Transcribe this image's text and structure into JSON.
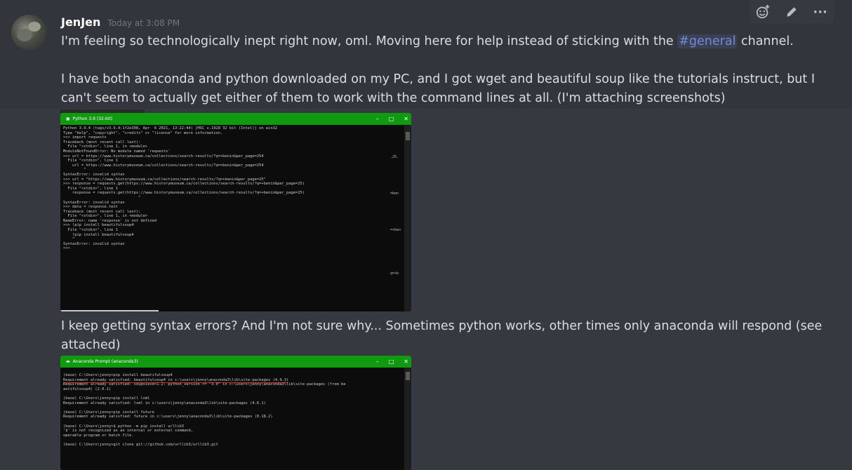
{
  "message": {
    "username": "JenJen",
    "timestamp": "Today at 3:08 PM",
    "p1_before": "I'm feeling so technologically inept right now, oml. Moving here for help instead of sticking with the ",
    "p1_mention": "#general",
    "p1_after": " channel.",
    "p2": "I have both anaconda and python downloaded on my PC, and I got wget and beautiful soup like the tutorials instruct, but I can't seem to actually get either of them to work with the command lines at all. (I'm attaching screenshots)",
    "p3": "I keep getting syntax errors? And I'm not sure why... Sometimes python works, other times only anaconda will respond (see attached)"
  },
  "toolbar": {
    "icons": [
      "add-reaction-icon",
      "edit-icon",
      "more-icon"
    ],
    "more_label": "···"
  },
  "attachment1": {
    "title": "Python 3.9 (32-bit)",
    "controls": [
      "–",
      "□",
      "✕"
    ],
    "side_fragments": [
      ".25.",
      "=ben",
      "=+ben",
      "q=+b"
    ],
    "console": "Python 3.9.4 (tags/v3.9.4:1f2e308, Apr  6 2021, 13:22:44) [MSC v.1928 32 bit (Intel)] on win32\nType \"help\", \"copyright\", \"credits\" or \"license\" for more information.\n>>> import requests\nTraceback (most recent call last):\n  File \"<stdin>\", line 1, in <module>\nModuleNotFoundError: No module named 'requests'\n>>> url = https://www.historymuseum.ca/collections/search-results/?q=+benin&per_page=254\n  File \"<stdin>\", line 1\n    url = https://www.historymuseum.ca/collections/search-results/?q=+benin&per_page=254\n         ^\nSyntaxError: invalid syntax\n>>> url = \"https://www.historymuseum.ca/collections/search-results/?q=+benin&per_page=25\"\n>>> response = requests.get(https://www.historymuseum.ca/collections/search-results/?q=+benin&per_page=25)\n  File \"<stdin>\", line 1\n    response = requests.get(https://www.historymuseum.ca/collections/search-results/?q=+benin&per_page=25)\n                                 ^\nSyntaxError: invalid syntax\n>>> data = response.text\nTraceback (most recent call last):\n  File \"<stdin>\", line 1, in <module>\nNameError: name 'response' is not defined\n>>> !pip install beautifulsoup4\n  File \"<stdin>\", line 1\n    !pip install beautifulsoup4\n    ^\nSyntaxError: invalid syntax\n>>>"
  },
  "attachment2": {
    "title": "Anaconda Prompt (anaconda3)",
    "controls": [
      "–",
      "□",
      "✕"
    ],
    "line_cmd1": "(base) C:\\Users\\jenny>pip install beautifulsoup4",
    "line_req1": "Requirement already satisfied: beautifulsoup4 in c:\\users\\jenny\\anaconda3\\lib\\site-packages (4.9.3)",
    "console_rest": "Requirement already satisfied: soupsieve>1.2; python_version >= \"3.0\" in c:\\users\\jenny\\anaconda3\\lib\\site-packages (from be\nautifulsoup4) (2.0.1)\n\n(base) C:\\Users\\jenny>pip install lxml\nRequirement already satisfied: lxml in c:\\users\\jenny\\anaconda3\\lib\\site-packages (4.6.1)\n\n(base) C:\\Users\\jenny>pip install future\nRequirement already satisfied: future in c:\\users\\jenny\\anaconda3\\lib\\site-packages (0.18.2)\n\n(base) C:\\Users\\jenny>$ python -m pip install urllib3\n'$' is not recognized as an internal or external command,\noperable program or batch file.\n\n(base) C:\\Users\\jenny>git clone git://github.com/urllib3/urllib3.git"
  }
}
